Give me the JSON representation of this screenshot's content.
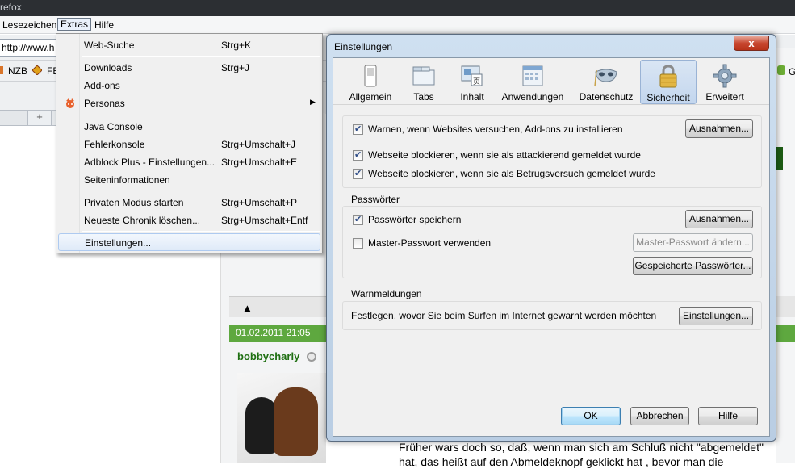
{
  "window": {
    "title_fragment": "refox"
  },
  "menubar": {
    "items": [
      "Lesezeichen",
      "Extras",
      "Hilfe"
    ]
  },
  "navbar": {
    "url_fragment": "http://www.h"
  },
  "bookmarks": {
    "nzb": "NZB",
    "fb": "FB",
    "g": "G"
  },
  "page": {
    "post_date": "01.02.2011 21:05",
    "username": "bobbycharly",
    "post_line1": "Früher wars doch so, daß, wenn man sich am Schluß nicht \"abgemeldet\"",
    "post_line2": "hat, das heißt auf den Abmeldeknopf geklickt hat , bevor man die"
  },
  "menu": {
    "items": [
      {
        "label": "Web-Suche",
        "accel": "Strg+K"
      },
      {
        "label": "Downloads",
        "accel": "Strg+J"
      },
      {
        "label": "Add-ons",
        "accel": ""
      },
      {
        "label": "Personas",
        "accel": ""
      },
      {
        "label": "Java Console",
        "accel": ""
      },
      {
        "label": "Fehlerkonsole",
        "accel": "Strg+Umschalt+J"
      },
      {
        "label": "Adblock Plus - Einstellungen...",
        "accel": "Strg+Umschalt+E"
      },
      {
        "label": "Seiteninformationen",
        "accel": ""
      },
      {
        "label": "Privaten Modus starten",
        "accel": "Strg+Umschalt+P"
      },
      {
        "label": "Neueste Chronik löschen...",
        "accel": "Strg+Umschalt+Entf"
      },
      {
        "label": "Einstellungen...",
        "accel": ""
      }
    ]
  },
  "dialog": {
    "title": "Einstellungen",
    "close": "x",
    "tabs": [
      "Allgemein",
      "Tabs",
      "Inhalt",
      "Anwendungen",
      "Datenschutz",
      "Sicherheit",
      "Erweitert"
    ],
    "active_tab": "Sicherheit",
    "security": {
      "warn_addons": "Warnen, wenn Websites versuchen, Add-ons zu installieren",
      "block_attack": "Webseite blockieren, wenn sie als attackierend gemeldet wurde",
      "block_forgery": "Webseite blockieren, wenn sie als Betrugsversuch gemeldet wurde",
      "exceptions1": "Ausnahmen...",
      "warn_addons_checked": true,
      "block_attack_checked": true,
      "block_forgery_checked": true
    },
    "passwords": {
      "title": "Passwörter",
      "save_label": "Passwörter speichern",
      "save_checked": true,
      "exceptions": "Ausnahmen...",
      "master_label": "Master-Passwort verwenden",
      "master_checked": false,
      "master_change": "Master-Passwort ändern...",
      "saved_passwords": "Gespeicherte Passwörter..."
    },
    "warnings": {
      "title": "Warnmeldungen",
      "text": "Festlegen, wovor Sie beim Surfen im Internet gewarnt werden möchten",
      "settings": "Einstellungen..."
    },
    "buttons": {
      "ok": "OK",
      "cancel": "Abbrechen",
      "help": "Hilfe"
    }
  },
  "colors": {
    "forum_green": "#5ea83f",
    "dialog_frame": "#b9cde3",
    "active_tab": "#c3d6ee"
  }
}
